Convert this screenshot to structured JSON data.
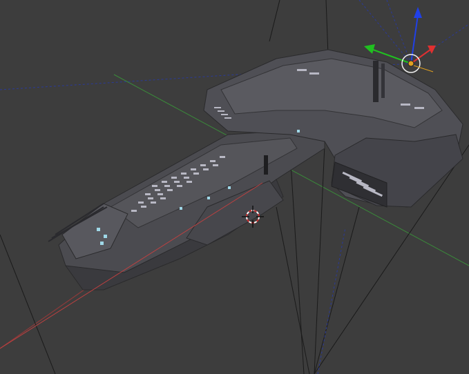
{
  "viewport": {
    "background": "#3d3d3d",
    "grid_x_axis_color": "#8b3a3a",
    "grid_y_axis_color": "#3a8b3a",
    "ship_base_color": "#4a4a4e",
    "ship_edge_color": "#2a2a2c",
    "window_color": "#c8c8d0",
    "glow_color": "#9fd8e8"
  },
  "gizmo": {
    "x_color": "#e03030",
    "y_color": "#20c020",
    "z_color": "#2040e8",
    "pivot_color": "#e0a020",
    "x_arrow_icon": "arrow-x-icon",
    "y_arrow_icon": "arrow-y-icon",
    "z_arrow_icon": "arrow-z-icon",
    "pivot_icon": "pivot-ring-icon"
  },
  "cursor": {
    "icon": "3d-cursor-icon",
    "ring_color": "#d03030",
    "cross_color": "#111111"
  }
}
